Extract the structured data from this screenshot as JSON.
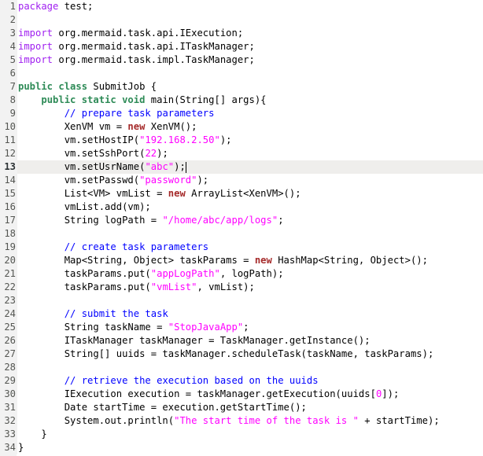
{
  "editor": {
    "current_line": 13,
    "colors": {
      "keyword": "#a020f0",
      "modifier": "#2e8b57",
      "new_keyword": "#a52a2a",
      "string": "#ff00ff",
      "comment": "#0000ff",
      "gutter_bg": "#f2f2f2",
      "current_line_bg": "#efeeec"
    },
    "lines": [
      {
        "n": "1",
        "tokens": [
          {
            "t": "kw",
            "v": "package"
          },
          {
            "t": "p",
            "v": " test;"
          }
        ]
      },
      {
        "n": "2",
        "tokens": []
      },
      {
        "n": "3",
        "tokens": [
          {
            "t": "kw",
            "v": "import"
          },
          {
            "t": "p",
            "v": " org.mermaid.task.api.IExecution;"
          }
        ]
      },
      {
        "n": "4",
        "tokens": [
          {
            "t": "kw",
            "v": "import"
          },
          {
            "t": "p",
            "v": " org.mermaid.task.api.ITaskManager;"
          }
        ]
      },
      {
        "n": "5",
        "tokens": [
          {
            "t": "kw",
            "v": "import"
          },
          {
            "t": "p",
            "v": " org.mermaid.task.impl.TaskManager;"
          }
        ]
      },
      {
        "n": "6",
        "tokens": []
      },
      {
        "n": "7",
        "tokens": [
          {
            "t": "kwb",
            "v": "public class"
          },
          {
            "t": "p",
            "v": " SubmitJob {"
          }
        ]
      },
      {
        "n": "8",
        "tokens": [
          {
            "t": "p",
            "v": "    "
          },
          {
            "t": "kwb",
            "v": "public static void"
          },
          {
            "t": "p",
            "v": " main(String[] args){"
          }
        ]
      },
      {
        "n": "9",
        "tokens": [
          {
            "t": "p",
            "v": "        "
          },
          {
            "t": "cmt",
            "v": "// prepare task parameters"
          }
        ]
      },
      {
        "n": "10",
        "tokens": [
          {
            "t": "p",
            "v": "        XenVM vm = "
          },
          {
            "t": "new",
            "v": "new"
          },
          {
            "t": "p",
            "v": " XenVM();"
          }
        ]
      },
      {
        "n": "11",
        "tokens": [
          {
            "t": "p",
            "v": "        vm.setHostIP("
          },
          {
            "t": "str",
            "v": "\"192.168.2.50\""
          },
          {
            "t": "p",
            "v": ");"
          }
        ]
      },
      {
        "n": "12",
        "tokens": [
          {
            "t": "p",
            "v": "        vm.setSshPort("
          },
          {
            "t": "num",
            "v": "22"
          },
          {
            "t": "p",
            "v": ");"
          }
        ]
      },
      {
        "n": "13",
        "tokens": [
          {
            "t": "p",
            "v": "        vm.setUsrName("
          },
          {
            "t": "str",
            "v": "\"abc\""
          },
          {
            "t": "p",
            "v": ");"
          },
          {
            "t": "caret",
            "v": ""
          }
        ]
      },
      {
        "n": "14",
        "tokens": [
          {
            "t": "p",
            "v": "        vm.setPasswd("
          },
          {
            "t": "str",
            "v": "\"password\""
          },
          {
            "t": "p",
            "v": ");"
          }
        ]
      },
      {
        "n": "15",
        "tokens": [
          {
            "t": "p",
            "v": "        List<VM> vmList = "
          },
          {
            "t": "new",
            "v": "new"
          },
          {
            "t": "p",
            "v": " ArrayList<XenVM>();"
          }
        ]
      },
      {
        "n": "16",
        "tokens": [
          {
            "t": "p",
            "v": "        vmList.add(vm);"
          }
        ]
      },
      {
        "n": "17",
        "tokens": [
          {
            "t": "p",
            "v": "        String logPath = "
          },
          {
            "t": "str",
            "v": "\"/home/abc/app/logs\""
          },
          {
            "t": "p",
            "v": ";"
          }
        ]
      },
      {
        "n": "18",
        "tokens": []
      },
      {
        "n": "19",
        "tokens": [
          {
            "t": "p",
            "v": "        "
          },
          {
            "t": "cmt",
            "v": "// create task parameters"
          }
        ]
      },
      {
        "n": "20",
        "tokens": [
          {
            "t": "p",
            "v": "        Map<String, Object> taskParams = "
          },
          {
            "t": "new",
            "v": "new"
          },
          {
            "t": "p",
            "v": " HashMap<String, Object>();"
          }
        ]
      },
      {
        "n": "21",
        "tokens": [
          {
            "t": "p",
            "v": "        taskParams.put("
          },
          {
            "t": "str",
            "v": "\"appLogPath\""
          },
          {
            "t": "p",
            "v": ", logPath);"
          }
        ]
      },
      {
        "n": "22",
        "tokens": [
          {
            "t": "p",
            "v": "        taskParams.put("
          },
          {
            "t": "str",
            "v": "\"vmList\""
          },
          {
            "t": "p",
            "v": ", vmList);"
          }
        ]
      },
      {
        "n": "23",
        "tokens": []
      },
      {
        "n": "24",
        "tokens": [
          {
            "t": "p",
            "v": "        "
          },
          {
            "t": "cmt",
            "v": "// submit the task"
          }
        ]
      },
      {
        "n": "25",
        "tokens": [
          {
            "t": "p",
            "v": "        String taskName = "
          },
          {
            "t": "str",
            "v": "\"StopJavaApp\""
          },
          {
            "t": "p",
            "v": ";"
          }
        ]
      },
      {
        "n": "26",
        "tokens": [
          {
            "t": "p",
            "v": "        ITaskManager taskManager = TaskManager.getInstance();"
          }
        ]
      },
      {
        "n": "27",
        "tokens": [
          {
            "t": "p",
            "v": "        String[] uuids = taskManager.scheduleTask(taskName, taskParams);"
          }
        ]
      },
      {
        "n": "28",
        "tokens": []
      },
      {
        "n": "29",
        "tokens": [
          {
            "t": "p",
            "v": "        "
          },
          {
            "t": "cmt",
            "v": "// retrieve the execution based on the uuids"
          }
        ]
      },
      {
        "n": "30",
        "tokens": [
          {
            "t": "p",
            "v": "        IExecution execution = taskManager.getExecution(uuids["
          },
          {
            "t": "num",
            "v": "0"
          },
          {
            "t": "p",
            "v": "]);"
          }
        ]
      },
      {
        "n": "31",
        "tokens": [
          {
            "t": "p",
            "v": "        Date startTime = execution.getStartTime();"
          }
        ]
      },
      {
        "n": "32",
        "tokens": [
          {
            "t": "p",
            "v": "        System.out.println("
          },
          {
            "t": "str",
            "v": "\"The start time of the task is \""
          },
          {
            "t": "p",
            "v": " + startTime);"
          }
        ]
      },
      {
        "n": "33",
        "tokens": [
          {
            "t": "p",
            "v": "    }"
          }
        ]
      },
      {
        "n": "34",
        "tokens": [
          {
            "t": "p",
            "v": "}"
          }
        ]
      }
    ]
  }
}
